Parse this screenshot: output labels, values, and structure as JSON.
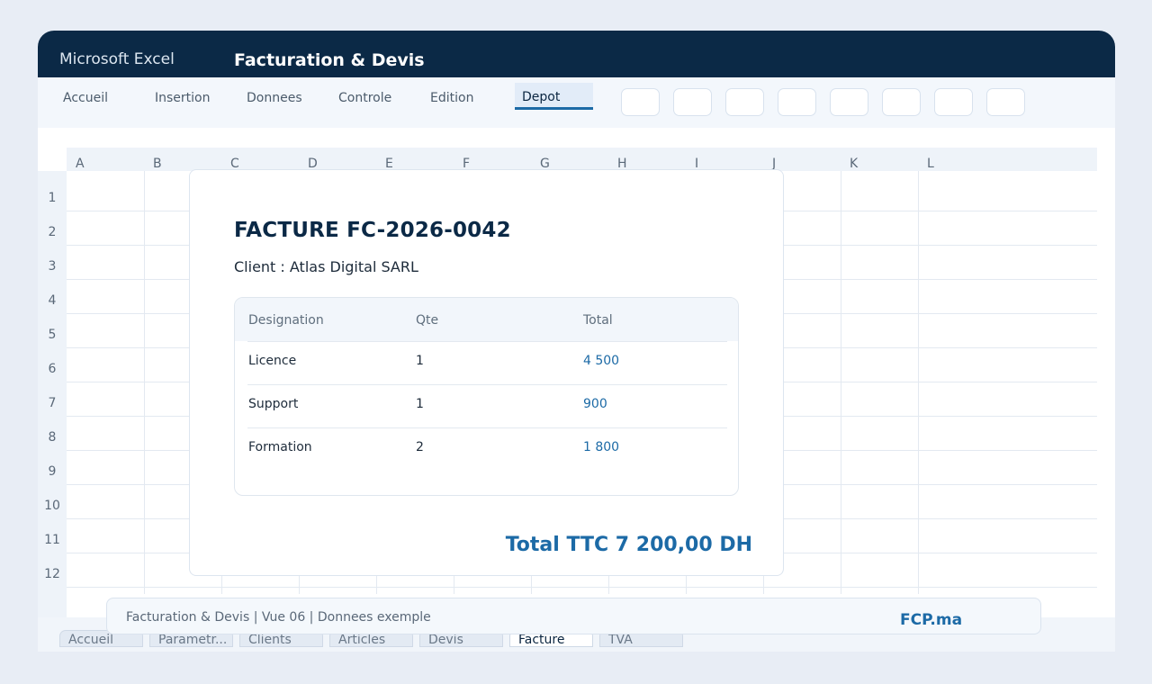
{
  "window": {
    "app_name": "Microsoft Excel",
    "doc_title": "Facturation & Devis"
  },
  "ribbon": {
    "tabs": [
      {
        "label": "Accueil"
      },
      {
        "label": "Insertion"
      },
      {
        "label": "Donnees"
      },
      {
        "label": "Controle"
      },
      {
        "label": "Edition"
      },
      {
        "label": "Depot"
      }
    ],
    "active_tab": "Depot"
  },
  "grid": {
    "columns": [
      "A",
      "B",
      "C",
      "D",
      "E",
      "F",
      "G",
      "H",
      "I",
      "J",
      "K",
      "L"
    ],
    "rows": [
      "1",
      "2",
      "3",
      "4",
      "5",
      "6",
      "7",
      "8",
      "9",
      "10",
      "11",
      "12"
    ]
  },
  "invoice": {
    "title": "FACTURE FC-2026-0042",
    "client": "Client : Atlas Digital SARL",
    "headers": [
      "Designation",
      "Qte",
      "Total"
    ],
    "rows": [
      {
        "designation": "Licence",
        "qte": "1",
        "total": "4 500"
      },
      {
        "designation": "Support",
        "qte": "1",
        "total": "900"
      },
      {
        "designation": "Formation",
        "qte": "2",
        "total": "1 800"
      }
    ],
    "total": "Total TTC 7 200,00 DH"
  },
  "footer": {
    "text": "Facturation & Devis | Vue 06 | Donnees exemple",
    "brand": "FCP.ma"
  },
  "sheets": {
    "tabs": [
      "Accueil",
      "Parametr...",
      "Clients",
      "Articles",
      "Devis",
      "Facture",
      "TVA"
    ],
    "active": "Facture"
  },
  "colors": {
    "title_bar": "#0b2946",
    "accent": "#1c6aa6"
  }
}
